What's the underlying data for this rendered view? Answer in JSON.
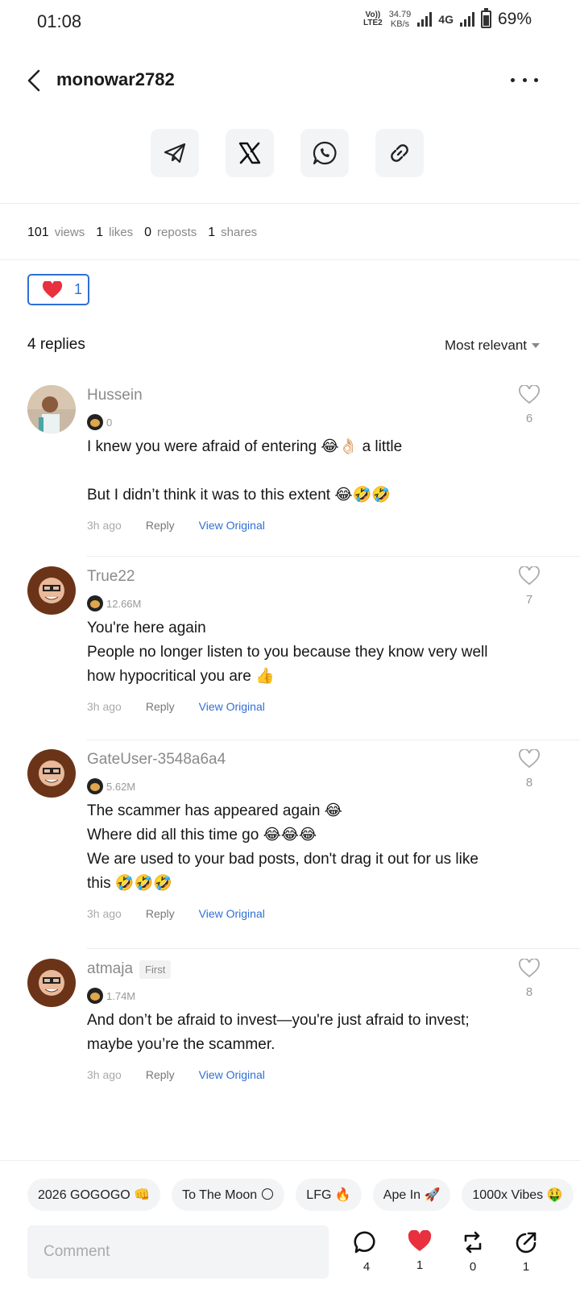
{
  "status_bar": {
    "time": "01:08",
    "volte_top": "Vo))",
    "volte_bottom": "LTE2",
    "net_speed_value": "34.79",
    "net_speed_unit": "KB/s",
    "network_type": "4G",
    "battery": "69%"
  },
  "header": {
    "title": "monowar2782",
    "back_icon": "chevron-left-icon",
    "more_icon": "more-horizontal-icon"
  },
  "share_buttons": [
    {
      "icon": "telegram-icon"
    },
    {
      "icon": "x-icon"
    },
    {
      "icon": "whatsapp-icon"
    },
    {
      "icon": "link-icon"
    }
  ],
  "stats": {
    "views_value": "101",
    "views_label": "views",
    "likes_value": "1",
    "likes_label": "likes",
    "reposts_value": "0",
    "reposts_label": "reposts",
    "shares_value": "1",
    "shares_label": "shares"
  },
  "reaction": {
    "icon": "heart-icon",
    "count": "1",
    "color": "#2f6fd6"
  },
  "replies": {
    "count_label": "4 replies",
    "sort_label": "Most relevant"
  },
  "comments": [
    {
      "username": "Hussein",
      "badge": "",
      "followers": "0",
      "lines": [
        "I knew you were afraid of entering 😂👌🏻 a little",
        "",
        "But I didn’t think it was to this extent 😂🤣🤣"
      ],
      "time": "3h ago",
      "reply": "Reply",
      "view_original": "View Original",
      "likes": "6"
    },
    {
      "username": "True22",
      "badge": "",
      "followers": "12.66M",
      "lines": [
        "You're here again",
        "People no longer listen to you because they know very well",
        "how hypocritical you are 👍"
      ],
      "time": "3h ago",
      "reply": "Reply",
      "view_original": "View Original",
      "likes": "7"
    },
    {
      "username": "GateUser-3548a6a4",
      "badge": "",
      "followers": "5.62M",
      "lines": [
        "The scammer has appeared again 😂",
        "Where did all this time go 😂😂😂",
        "We are used to your bad posts, don't drag it out for us like",
        "this 🤣🤣🤣"
      ],
      "time": "3h ago",
      "reply": "Reply",
      "view_original": "View Original",
      "likes": "8"
    },
    {
      "username": "atmaja",
      "badge": "First",
      "followers": "1.74M",
      "lines": [
        "And don’t be afraid to invest—you're just afraid to invest;",
        "maybe you’re the scammer."
      ],
      "time": "3h ago",
      "reply": "Reply",
      "view_original": "View Original",
      "likes": "8"
    }
  ],
  "quick_replies": [
    "2026 GOGOGO 👊",
    "To The Moon 🌕",
    "LFG 🔥",
    "Ape In 🚀",
    "1000x Vibes 🤑"
  ],
  "comment_input": {
    "placeholder": "Comment"
  },
  "bottom_actions": {
    "comments": "4",
    "likes": "1",
    "reposts": "0",
    "shares": "1"
  },
  "colors": {
    "accent_blue": "#2f6fd6",
    "heart_red": "#e8303f"
  }
}
